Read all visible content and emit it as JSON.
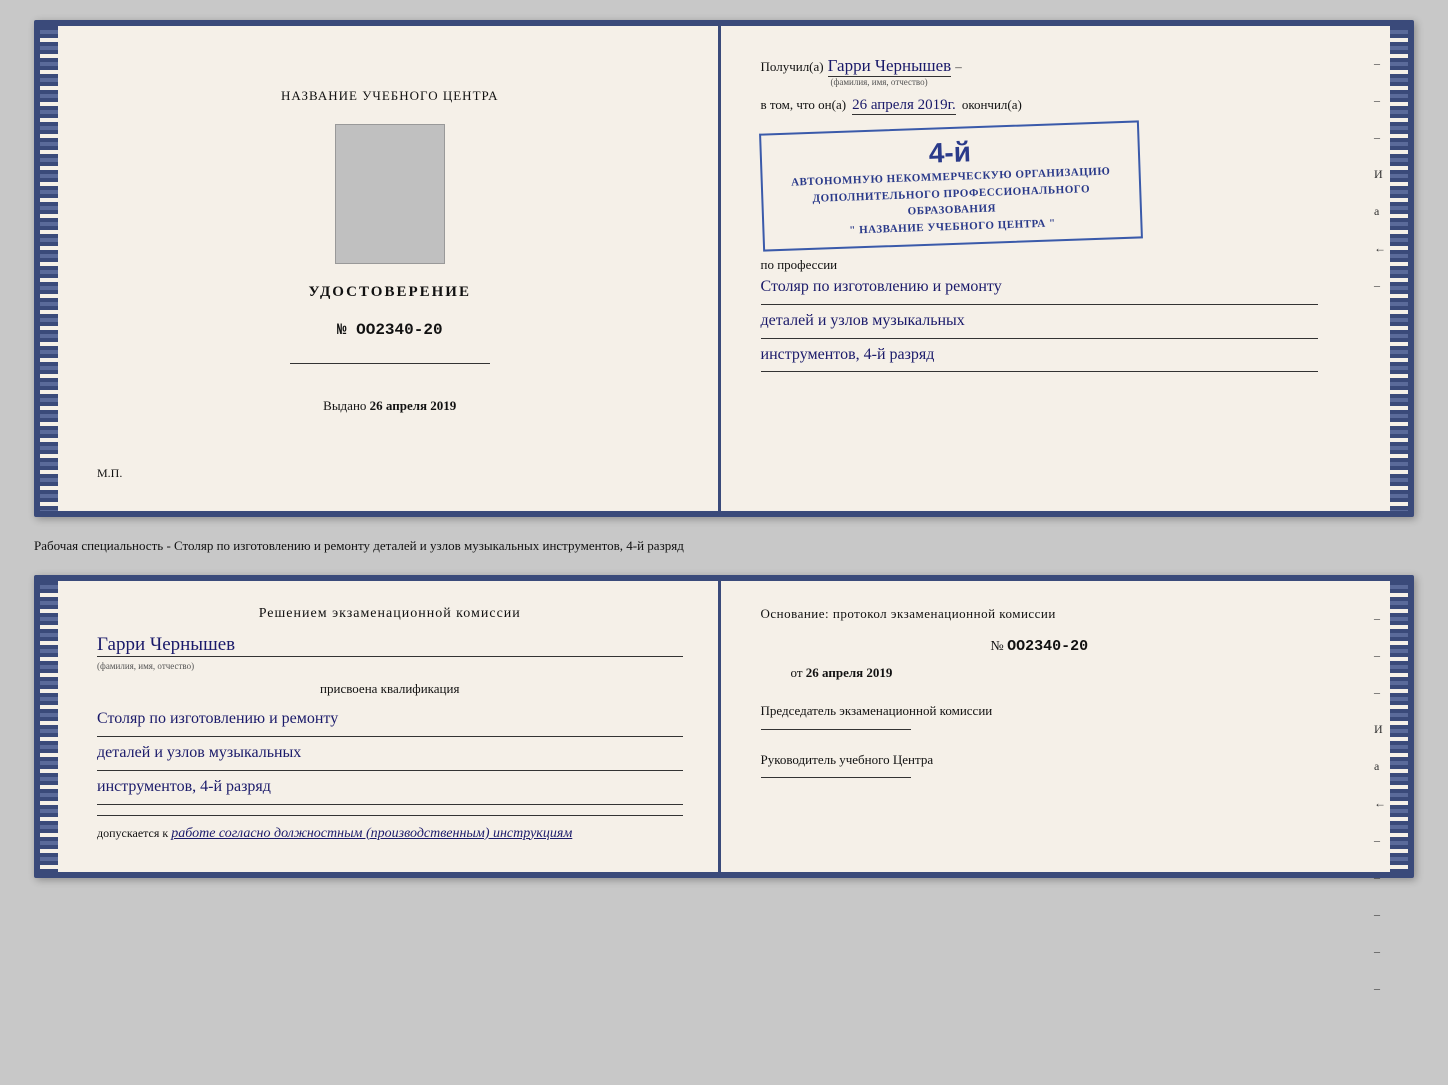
{
  "top": {
    "left": {
      "center_title": "НАЗВАНИЕ УЧЕБНОГО ЦЕНТРА",
      "certificate_label": "УДОСТОВЕРЕНИЕ",
      "certificate_number": "№ OO2340-20",
      "issued_label": "Выдано",
      "issued_date": "26 апреля 2019",
      "mp_label": "М.П."
    },
    "right": {
      "received_label": "Получил(а)",
      "recipient_name": "Гарри Чернышев",
      "fio_label": "(фамилия, имя, отчество)",
      "vtom_label": "в том, что он(а)",
      "date_value": "26 апреля 2019г.",
      "okончил_label": "окончил(а)",
      "stamp_number": "4-й",
      "stamp_line1": "АВТОНОМНУЮ НЕКОММЕРЧЕСКУЮ ОРГАНИЗАЦИЮ",
      "stamp_line2": "ДОПОЛНИТЕЛЬНОГО ПРОФЕССИОНАЛЬНОГО ОБРАЗОВАНИЯ",
      "stamp_line3": "\" НАЗВАНИЕ УЧЕБНОГО ЦЕНТРА \"",
      "profession_label": "по профессии",
      "profession_line1": "Столяр по изготовлению и ремонту",
      "profession_line2": "деталей и узлов музыкальных",
      "profession_line3": "инструментов, 4-й разряд"
    }
  },
  "separator": {
    "text": "Рабочая специальность - Столяр по изготовлению и ремонту деталей и узлов музыкальных инструментов, 4-й разряд"
  },
  "bottom": {
    "left": {
      "komissia_title": "Решением  экзаменационной  комиссии",
      "recipient_name": "Гарри Чернышев",
      "fio_label": "(фамилия, имя, отчество)",
      "assigned_text": "присвоена квалификация",
      "qualification_line1": "Столяр по изготовлению и ремонту",
      "qualification_line2": "деталей и узлов музыкальных",
      "qualification_line3": "инструментов, 4-й разряд",
      "allowed_prefix": "допускается к",
      "allowed_text": "работе согласно должностным (производственным) инструкциям"
    },
    "right": {
      "osnov_label": "Основание: протокол экзаменационной  комиссии",
      "number_label": "№",
      "number_value": "OO2340-20",
      "date_prefix": "от",
      "date_value": "26 апреля 2019",
      "chairman_title": "Председатель экзаменационной комиссии",
      "director_title": "Руководитель учебного Центра"
    },
    "side_chars": [
      "–",
      "–",
      "–",
      "И",
      "а",
      "←",
      "–",
      "–",
      "–",
      "–",
      "–"
    ]
  }
}
